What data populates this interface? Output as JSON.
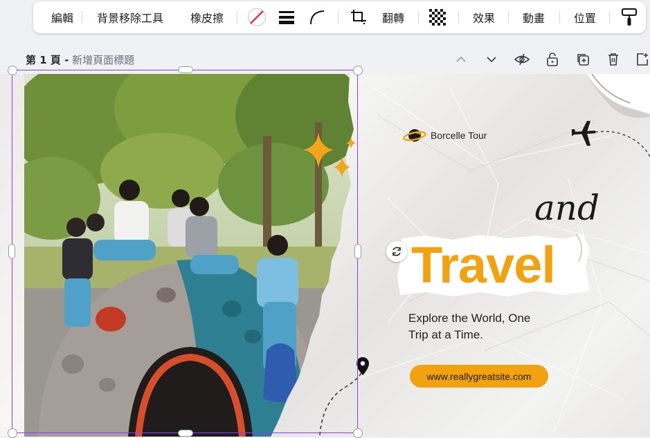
{
  "toolbar": {
    "edit": "編輯",
    "bg_remover": "背景移除工具",
    "eraser": "橡皮擦",
    "flip": "翻轉",
    "effects": "效果",
    "animate": "動畫",
    "position": "位置"
  },
  "page": {
    "label": "第 1 頁 -",
    "title_placeholder": "新增頁面標題"
  },
  "design": {
    "brand_name": "Borcelle Tour",
    "and_text": "and",
    "travel_text": "Travel",
    "tagline_line1": "Explore the World, One",
    "tagline_line2": "Trip at a Time.",
    "url": "www.reallygreatsite.com"
  },
  "colors": {
    "accent": "#f2a20f",
    "selection": "#8b3dff",
    "toolbar_bg": "#ffffff",
    "workspace_bg": "#f0f1f5"
  },
  "icons": [
    "color-slash-icon",
    "border-weight-icon",
    "corner-rounding-icon",
    "crop-icon",
    "transparency-icon",
    "copy-style-icon",
    "chevron-up-icon",
    "chevron-down-icon",
    "hide-icon",
    "lock-icon",
    "duplicate-icon",
    "delete-icon",
    "add-page-icon",
    "rotate-icon",
    "airplane-icon",
    "map-pin-icon",
    "planet-logo-icon",
    "sparkle-icon"
  ]
}
